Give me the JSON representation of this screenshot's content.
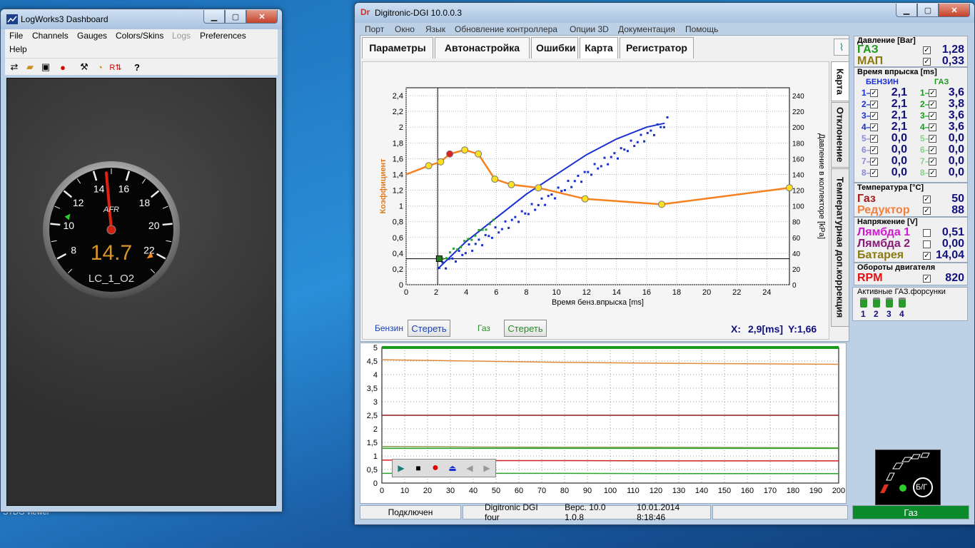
{
  "desktop": {
    "label": "STDG viewer"
  },
  "logworks": {
    "title": "LogWorks3 Dashboard",
    "menu": [
      "File",
      "Channels",
      "Gauges",
      "Colors/Skins",
      "Logs",
      "Preferences",
      "Help"
    ],
    "gauge": {
      "label": "AFR",
      "value": "14.7",
      "value_numeric": 14.7,
      "channel": "LC_1_O2",
      "ticks": [
        "8",
        "10",
        "12",
        "14",
        "16",
        "18",
        "20",
        "22"
      ],
      "scale_min": 7,
      "scale_max": 23
    }
  },
  "digitronic": {
    "title": "Digitronic-DGI  10.0.0.3",
    "menu": [
      "Порт",
      "Окно",
      "Язык",
      "Обновление контроллера",
      "Опции 3D",
      "Документация",
      "Помощь"
    ],
    "tabs": [
      "Параметры",
      "Автонастройка",
      "Ошибки",
      "Карта",
      "Регистратор"
    ],
    "side_tabs": [
      "Карта",
      "Отклонение",
      "Температурная доп.коррекция"
    ],
    "map_chart": {
      "xlabel": "Время бенз.впрыска [ms]",
      "ylabel_left": "Коэффициент",
      "ylabel_right": "Давление в коллекторе [kPa]",
      "x_ticks": [
        "0",
        "2",
        "4",
        "6",
        "8",
        "10",
        "12",
        "14",
        "16",
        "18",
        "20",
        "22",
        "24"
      ],
      "y_left_ticks": [
        "0",
        "0,2",
        "0,4",
        "0,6",
        "0,8",
        "1",
        "1,2",
        "1,4",
        "1,6",
        "1,8",
        "2",
        "2,2",
        "2,4"
      ],
      "y_right_ticks": [
        "0",
        "20",
        "40",
        "60",
        "80",
        "100",
        "120",
        "140",
        "160",
        "180",
        "200",
        "220",
        "240"
      ],
      "benzin_label": "Бензин",
      "gas_label": "Газ",
      "clear_label": "Стереть",
      "cursor_x_label": "X:",
      "cursor_x_value": "2,9[ms]",
      "cursor_y_label": "Y:1,66"
    },
    "chart_data": [
      {
        "type": "line",
        "series": [
          {
            "name": "Коэффициент",
            "color": "#f5821f",
            "x": [
              0,
              1.5,
              2.3,
              2.9,
              3.9,
              4.8,
              5.9,
              7.0,
              8.8,
              11.9,
              17.0,
              25.5
            ],
            "y": [
              1.4,
              1.51,
              1.56,
              1.66,
              1.71,
              1.66,
              1.34,
              1.27,
              1.23,
              1.09,
              1.02,
              1.23
            ]
          },
          {
            "name": "benzin_scatter_fit",
            "color": "#1a2fd0",
            "x": [
              2.1,
              4.0,
              6.0,
              8.0,
              10.0,
              12.0,
              14.0,
              16.0,
              17.2
            ],
            "y": [
              20,
              55,
              85,
              115,
              140,
              165,
              185,
              200,
              205
            ]
          },
          {
            "name": "gas_points",
            "color": "#2aa32a",
            "x": [
              2.2,
              3.0,
              3.8,
              4.5,
              5.2,
              5.8
            ],
            "y": [
              30,
              42,
              55,
              65,
              73,
              80
            ]
          }
        ],
        "xlim": [
          0,
          25.5
        ],
        "ylim_left": [
          0,
          2.5
        ],
        "ylim_right": [
          0,
          250
        ]
      },
      {
        "type": "line",
        "x_ticks": [
          "0",
          "10",
          "20",
          "30",
          "40",
          "50",
          "60",
          "70",
          "80",
          "90",
          "100",
          "110",
          "120",
          "130",
          "140",
          "150",
          "160",
          "170",
          "180",
          "190",
          "200"
        ],
        "y_ticks": [
          "0",
          "0,5",
          "1",
          "1,5",
          "2",
          "2,5",
          "3",
          "3,5",
          "4",
          "4,5",
          "5"
        ],
        "xlim": [
          0,
          200
        ],
        "ylim": [
          0,
          5
        ],
        "series": [
          {
            "name": "orange",
            "color": "#e08a3a",
            "y": [
              4.55,
              4.5,
              4.45,
              4.42,
              4.4,
              4.38
            ]
          },
          {
            "name": "dark-red",
            "color": "#8b1a1a",
            "y": [
              2.5,
              2.5,
              2.5,
              2.5,
              2.5,
              2.5
            ]
          },
          {
            "name": "olive",
            "color": "#8a9a4a",
            "y": [
              1.35,
              1.33,
              1.32,
              1.32,
              1.31,
              1.3
            ]
          },
          {
            "name": "green-top",
            "color": "#2aa32a",
            "y": [
              1.28,
              1.28,
              1.28,
              1.28,
              1.28,
              1.28
            ]
          },
          {
            "name": "red",
            "color": "#d02020",
            "y": [
              0.85,
              0.83,
              0.83,
              0.82,
              0.82,
              0.82
            ]
          },
          {
            "name": "green-low",
            "color": "#2aa32a",
            "y": [
              0.36,
              0.36,
              0.36,
              0.35,
              0.35,
              0.35
            ]
          },
          {
            "name": "top-green",
            "color": "#1a9a1a",
            "y": [
              5,
              5,
              5,
              5,
              5,
              5
            ]
          }
        ]
      }
    ],
    "right_panel": {
      "pressure": {
        "title": "Давление [Bar]",
        "gas_label": "ГАЗ",
        "gas_value": "1,28",
        "map_label": "МАП",
        "map_value": "0,33"
      },
      "injection": {
        "title": "Время впрыска [ms]",
        "benzin_header": "БЕНЗИН",
        "gas_header": "ГАЗ",
        "rows": [
          {
            "n": "1",
            "benzin": "2,1",
            "gas": "3,6"
          },
          {
            "n": "2",
            "benzin": "2,1",
            "gas": "3,8"
          },
          {
            "n": "3",
            "benzin": "2,1",
            "gas": "3,6"
          },
          {
            "n": "4",
            "benzin": "2,1",
            "gas": "3,6"
          },
          {
            "n": "5",
            "benzin": "0,0",
            "gas": "0,0"
          },
          {
            "n": "6",
            "benzin": "0,0",
            "gas": "0,0"
          },
          {
            "n": "7",
            "benzin": "0,0",
            "gas": "0,0"
          },
          {
            "n": "8",
            "benzin": "0,0",
            "gas": "0,0"
          }
        ]
      },
      "temperature": {
        "title": "Температура [°C]",
        "gas_label": "Газ",
        "gas_value": "50",
        "reducer_label": "Редуктор",
        "reducer_value": "88"
      },
      "voltage": {
        "title": "Напряжение [V]",
        "l1_label": "Лямбда 1",
        "l1_value": "0,51",
        "l2_label": "Лямбда 2",
        "l2_value": "0,00",
        "bat_label": "Батарея",
        "bat_value": "14,04"
      },
      "rpm": {
        "title": "Обороты двигателя",
        "label": "RPM",
        "value": "820"
      },
      "injectors": {
        "title": "Активные ГАЗ.форсунки",
        "labels": [
          "1",
          "2",
          "3",
          "4"
        ]
      },
      "switch_label": "Б/Г"
    },
    "status": {
      "connection": "Подключен",
      "device": "Digitronic DGI four",
      "version": "Верс. 10.0  1.0.8",
      "datetime": "10.01.2014 8:18:46",
      "fuel": "Газ"
    }
  }
}
